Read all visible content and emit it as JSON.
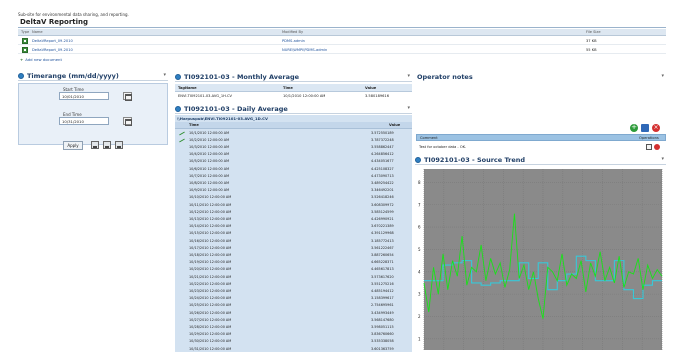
{
  "header": {
    "subtitle": "Sub-site for environmental data sharing, and reporting.",
    "site_title": "DeltaV Reporting"
  },
  "documents": {
    "columns": [
      "Type",
      "Name",
      "Modified By",
      "File Size"
    ],
    "rows": [
      {
        "name": "DeltaVReport_09-2010",
        "modified_by": "PDMS-admin",
        "size": "37 KB"
      },
      {
        "name": "DeltaVReport_09-2010",
        "modified_by": "NURE\\WMPI\\PDMS-admin",
        "size": "55 KB"
      }
    ],
    "add_label": "Add new document"
  },
  "timerange": {
    "title": "Timerange (mm/dd/yyyy)",
    "start_label": "Start Time",
    "start_value": "10/01/2010",
    "end_label": "End Time",
    "end_value": "10/31/2010",
    "apply_label": "Apply"
  },
  "monthly": {
    "title": "TI092101-03 - Monthly Average",
    "columns": [
      "TagName",
      "Time",
      "Value"
    ],
    "row": {
      "tag": "ENVI.TI092101-03.AVG_1H.CV",
      "time": "10/1/2010 12:00:00 AM",
      "value": "3.580189616"
    }
  },
  "daily": {
    "title": "TI092101-03 - Daily Average",
    "path": "\\\\Harpuspub\\ENVI.TI092101-03.AVG_1D.CV",
    "columns": [
      "Time",
      "Value"
    ],
    "rows": [
      {
        "time": "10/1/2010 12:00:00 AM",
        "value": "3.572550189"
      },
      {
        "time": "10/2/2010 12:00:00 AM",
        "value": "3.787372248"
      },
      {
        "time": "10/3/2010 12:00:00 AM",
        "value": "3.558862447"
      },
      {
        "time": "10/4/2010 12:00:00 AM",
        "value": "4.264856412"
      },
      {
        "time": "10/5/2010 12:00:00 AM",
        "value": "4.434051677"
      },
      {
        "time": "10/6/2010 12:00:00 AM",
        "value": "4.425108327"
      },
      {
        "time": "10/7/2010 12:00:00 AM",
        "value": "4.473090713"
      },
      {
        "time": "10/8/2010 12:00:00 AM",
        "value": "3.489254422"
      },
      {
        "time": "10/9/2010 12:00:00 AM",
        "value": "3.346492201"
      },
      {
        "time": "10/10/2010 12:00:00 AM",
        "value": "3.526418246"
      },
      {
        "time": "10/11/2010 12:00:00 AM",
        "value": "3.608309972"
      },
      {
        "time": "10/12/2010 12:00:00 AM",
        "value": "3.585124599"
      },
      {
        "time": "10/13/2010 12:00:00 AM",
        "value": "4.426990921"
      },
      {
        "time": "10/14/2010 12:00:00 AM",
        "value": "3.670221389"
      },
      {
        "time": "10/15/2010 12:00:00 AM",
        "value": "4.391129968"
      },
      {
        "time": "10/16/2010 12:00:00 AM",
        "value": "3.185772413"
      },
      {
        "time": "10/17/2010 12:00:00 AM",
        "value": "3.561222467"
      },
      {
        "time": "10/18/2010 12:00:00 AM",
        "value": "3.887260654"
      },
      {
        "time": "10/19/2010 12:00:00 AM",
        "value": "4.665228371"
      },
      {
        "time": "10/20/2010 12:00:00 AM",
        "value": "4.465617813"
      },
      {
        "time": "10/21/2010 12:00:00 AM",
        "value": "3.573617620"
      },
      {
        "time": "10/22/2010 12:00:00 AM",
        "value": "3.551275216"
      },
      {
        "time": "10/23/2010 12:00:00 AM",
        "value": "4.485194412"
      },
      {
        "time": "10/24/2010 12:00:00 AM",
        "value": "3.158399617"
      },
      {
        "time": "10/25/2010 12:00:00 AM",
        "value": "2.754695961"
      },
      {
        "time": "10/26/2010 12:00:00 AM",
        "value": "3.434993449"
      },
      {
        "time": "10/27/2010 12:00:00 AM",
        "value": "3.568147680"
      },
      {
        "time": "10/28/2010 12:00:00 AM",
        "value": "3.598051115"
      },
      {
        "time": "10/29/2010 12:00:00 AM",
        "value": "3.836760660"
      },
      {
        "time": "10/30/2010 12:00:00 AM",
        "value": "3.535338058"
      },
      {
        "time": "10/31/2010 12:00:00 AM",
        "value": "3.601363759"
      }
    ]
  },
  "notes": {
    "title": "Operator notes",
    "columns": [
      "Comment",
      "Operations"
    ],
    "row": {
      "comment": "Test for october data - OK."
    }
  },
  "trend": {
    "title": "TI092101-03 - Source Trend",
    "background": "#8a8a8a",
    "raw_color": "#19e219",
    "avg_color": "#38c8d8"
  },
  "chart_data": {
    "type": "line",
    "title": "TI092101-03 - Source Trend",
    "xlabel": "",
    "ylabel": "",
    "ylim": [
      0.5,
      8.6
    ],
    "yticks": [
      1,
      2,
      3,
      4,
      5,
      6,
      7,
      8
    ],
    "grid": true,
    "series": [
      {
        "x": [
          0,
          2,
          4,
          6,
          8,
          10,
          12,
          14,
          16,
          18,
          20,
          22,
          24,
          26,
          28,
          30,
          32,
          34,
          36,
          38,
          40,
          42,
          44,
          46,
          48,
          50,
          52,
          54,
          56,
          58,
          60,
          62,
          64,
          66,
          68,
          70,
          72,
          74,
          76,
          78,
          80,
          82,
          84,
          86,
          88,
          90,
          92,
          94,
          96,
          98,
          100
        ],
        "values": [
          3.5,
          2.2,
          4.2,
          3.0,
          4.8,
          3.2,
          4.5,
          3.8,
          5.6,
          3.4,
          4.2,
          4.0,
          5.2,
          3.6,
          4.6,
          3.9,
          4.4,
          3.3,
          4.1,
          6.6,
          3.7,
          4.3,
          3.2,
          4.0,
          2.8,
          1.9,
          4.2,
          4.0,
          3.6,
          4.8,
          3.4,
          3.9,
          3.7,
          4.5,
          3.1,
          4.4,
          3.8,
          4.9,
          3.6,
          4.2,
          3.5,
          4.7,
          3.3,
          4.0,
          3.9,
          4.6,
          3.2,
          4.3,
          3.7,
          4.1,
          3.8
        ]
      },
      {
        "x": [
          0,
          4,
          8,
          12,
          16,
          20,
          24,
          28,
          32,
          36,
          40,
          44,
          48,
          52,
          56,
          60,
          64,
          68,
          72,
          76,
          80,
          84,
          88,
          92,
          96,
          100
        ],
        "values": [
          3.6,
          3.6,
          4.3,
          4.4,
          4.5,
          3.5,
          3.4,
          3.5,
          3.6,
          3.6,
          4.4,
          3.7,
          4.4,
          3.2,
          3.6,
          3.9,
          4.7,
          4.5,
          3.6,
          3.6,
          4.5,
          3.2,
          2.8,
          3.4,
          3.6,
          3.6
        ]
      }
    ]
  }
}
